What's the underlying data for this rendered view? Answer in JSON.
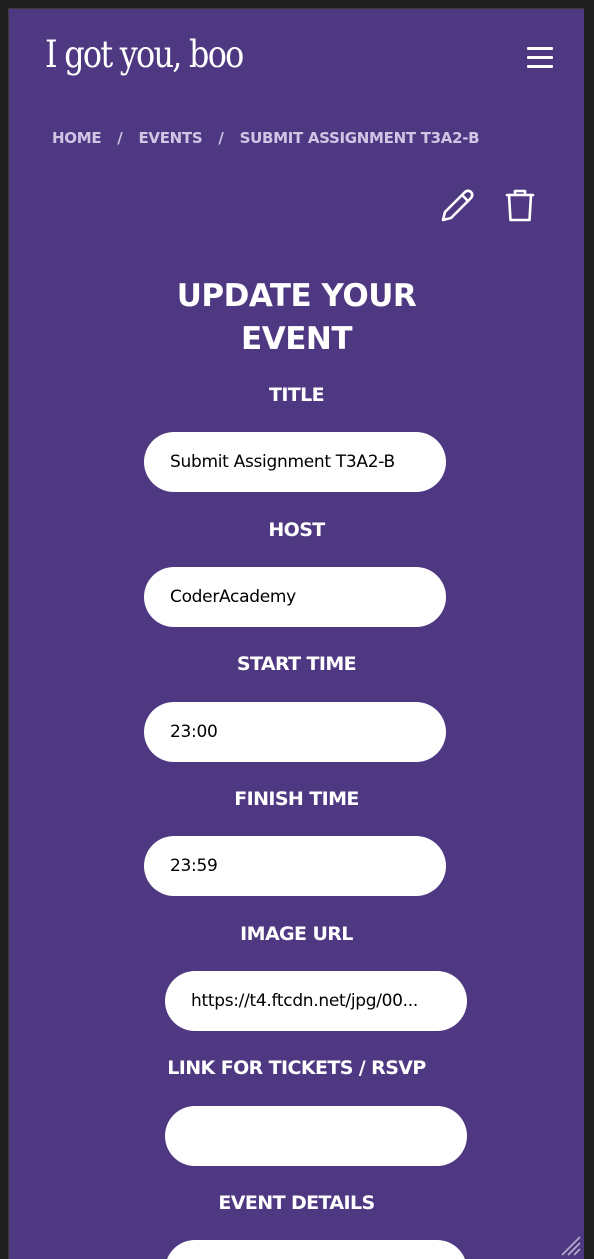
{
  "header": {
    "logo_text": "I got you, boo",
    "menu_icon": "hamburger-menu-icon"
  },
  "breadcrumb": {
    "items": [
      "HOME",
      "EVENTS",
      "SUBMIT ASSIGNMENT T3A2-B"
    ],
    "separator": "/"
  },
  "actions": {
    "edit_icon": "pencil-icon",
    "delete_icon": "trash-icon"
  },
  "form": {
    "heading_line1": "UPDATE YOUR",
    "heading_line2": "EVENT",
    "title_label": "TITLE",
    "title_value": "Submit Assignment T3A2-B",
    "host_label": "HOST",
    "host_value": "CoderAcademy",
    "start_time_label": "START TIME",
    "start_time_value": "23:00",
    "finish_time_label": "FINISH TIME",
    "finish_time_value": "23:59",
    "image_url_label": "IMAGE URL",
    "image_url_value": "https://t4.ftcdn.net/jpg/00...",
    "tickets_label": "LINK FOR TICKETS / RSVP",
    "tickets_value": "",
    "details_label": "EVENT DETAILS",
    "details_value": ""
  },
  "colors": {
    "background": "#4f3882",
    "text": "#ffffff",
    "breadcrumb": "#cfc6e6",
    "input_bg": "#ffffff"
  }
}
